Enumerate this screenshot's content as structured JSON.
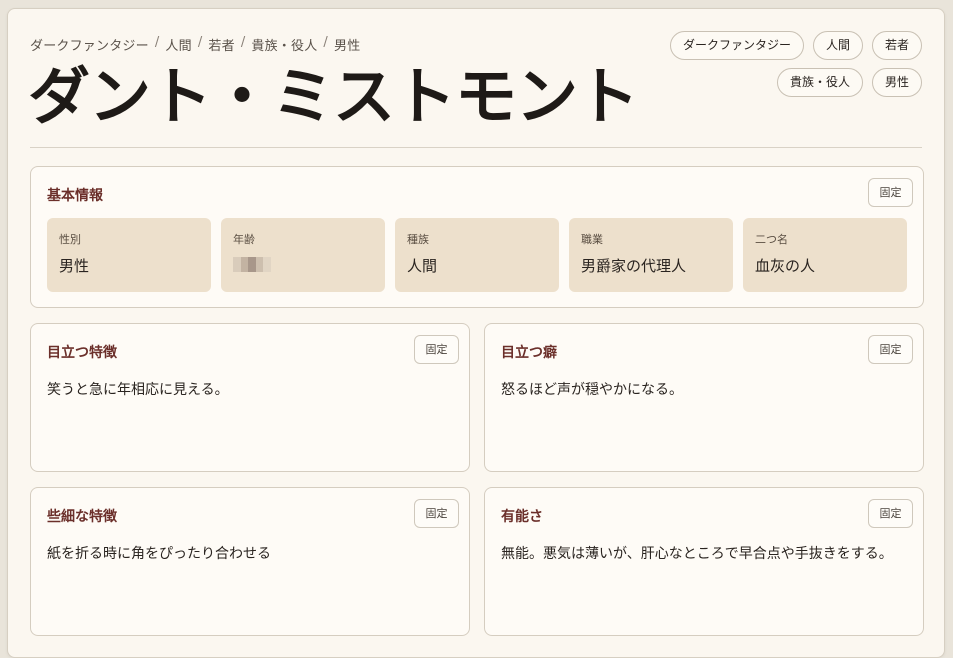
{
  "breadcrumb": [
    "ダークファンタジー",
    "人間",
    "若者",
    "貴族・役人",
    "男性"
  ],
  "breadcrumb_separator": "/",
  "title": "ダント・ミストモント",
  "tags": [
    "ダークファンタジー",
    "人間",
    "若者",
    "貴族・役人",
    "男性"
  ],
  "pin_label": "固定",
  "basic_info": {
    "heading": "基本情報",
    "fields": [
      {
        "label": "性別",
        "value": "男性"
      },
      {
        "label": "年齢",
        "value": null
      },
      {
        "label": "種族",
        "value": "人間"
      },
      {
        "label": "職業",
        "value": "男爵家の代理人"
      },
      {
        "label": "二つ名",
        "value": "血灰の人"
      }
    ]
  },
  "cards": [
    {
      "heading": "目立つ特徴",
      "text": "笑うと急に年相応に見える。"
    },
    {
      "heading": "目立つ癖",
      "text": "怒るほど声が穏やかになる。"
    },
    {
      "heading": "些細な特徴",
      "text": "紙を折る時に角をぴったり合わせる"
    },
    {
      "heading": "有能さ",
      "text": "無能。悪気は薄いが、肝心なところで早合点や手抜きをする。"
    }
  ],
  "colors": {
    "accent_heading": "#6b2f2a",
    "info_cell_bg": "#ede0cc",
    "page_bg": "#fbf7f0"
  },
  "icons": {
    "age_value": "pixelated-redaction"
  }
}
